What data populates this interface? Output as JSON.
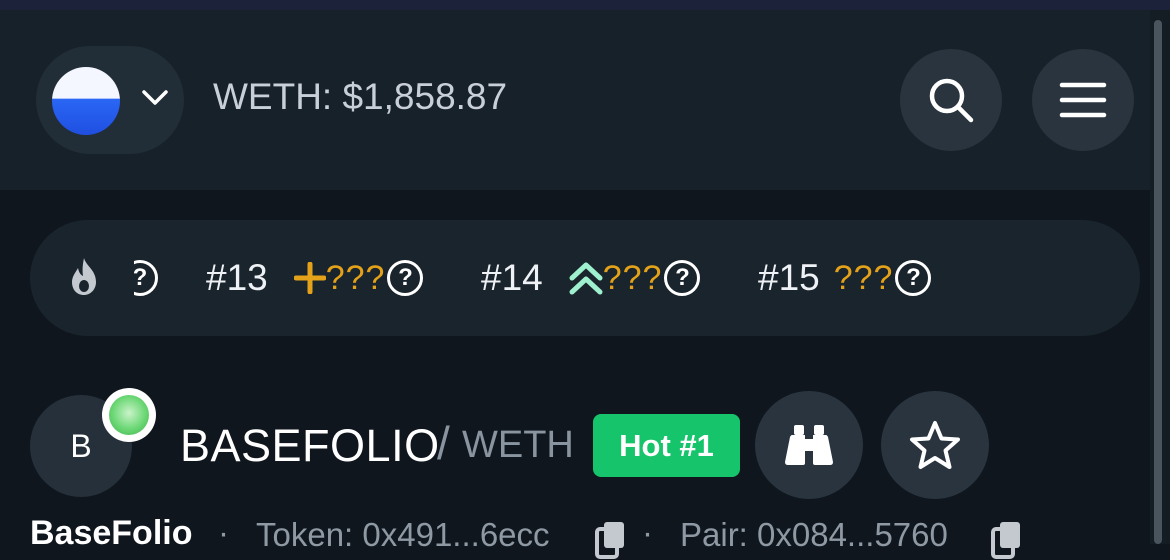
{
  "header": {
    "price_label": "WETH: $1,858.87"
  },
  "icons": {
    "chain": "chain-logo-icon",
    "chevron": "chevron-down-icon",
    "search": "search-icon",
    "menu": "hamburger-menu-icon",
    "fire": "fire-icon",
    "plus": "plus-icon",
    "double_up": "double-chevron-up-icon",
    "help": "question-circle-icon",
    "binoculars": "binoculars-icon",
    "star": "star-icon",
    "copy": "copy-icon"
  },
  "ticker": {
    "items": [
      {
        "rank": "#13",
        "value": "???"
      },
      {
        "rank": "#14",
        "value": "???"
      },
      {
        "rank": "#15",
        "value": "???"
      }
    ],
    "help_glyph": "?"
  },
  "token": {
    "avatar_letter": "B",
    "symbol": "BASEFOLIO",
    "separator": "/",
    "quote": "WETH",
    "hot_badge": "Hot #1",
    "name": "BaseFolio",
    "token_address": "Token: 0x491...6ecc",
    "pair_address": "Pair: 0x084...5760",
    "dot": "·"
  },
  "colors": {
    "background": "#0f161d",
    "header": "#17212a",
    "accent_green": "#16c46b",
    "accent_gold": "#e3a21a",
    "mint": "#9ef0cf"
  }
}
